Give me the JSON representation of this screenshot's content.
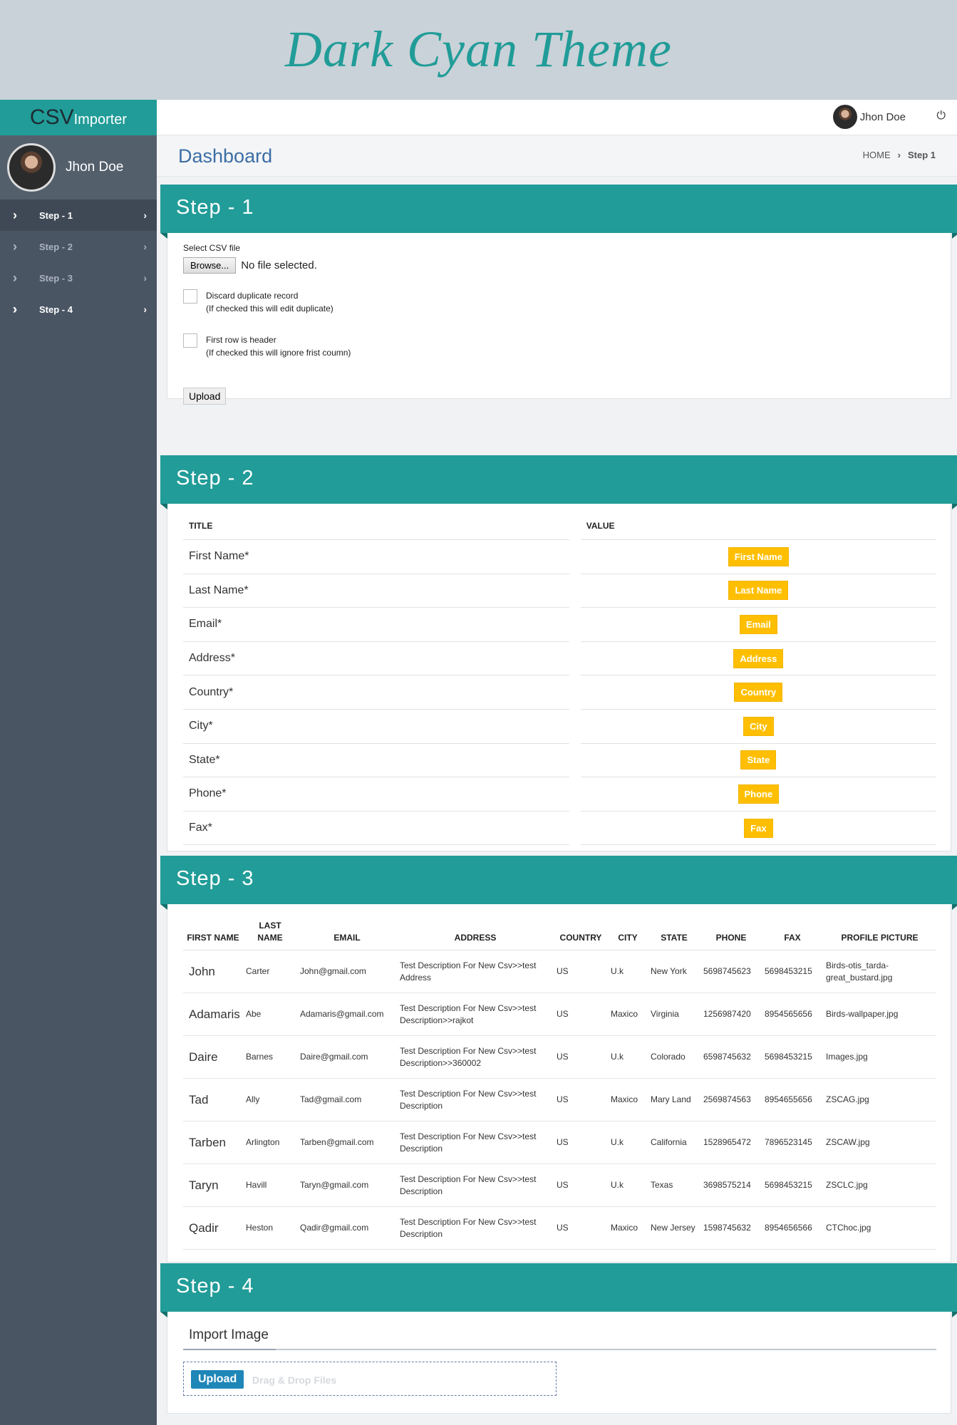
{
  "banner": {
    "title": "Dark Cyan Theme"
  },
  "brand": {
    "part1": "CSV",
    "part2": "Importer"
  },
  "user": {
    "name": "Jhon Doe"
  },
  "sidebar": {
    "items": [
      {
        "label": "Step - 1",
        "icon": "›"
      },
      {
        "label": "Step - 2",
        "icon": "››"
      },
      {
        "label": "Step - 3",
        "icon": "›››"
      },
      {
        "label": "Step - 4",
        "icon": "››››"
      }
    ],
    "chevron": "›"
  },
  "topbar": {
    "user": "Jhon Doe",
    "power_icon": "⏻"
  },
  "header": {
    "title": "Dashboard",
    "breadcrumb": {
      "home": "HOME",
      "sep": "›",
      "current": "Step 1"
    }
  },
  "step1": {
    "title": "Step - 1",
    "select_label": "Select CSV file",
    "browse": "Browse...",
    "file_status": "No file selected.",
    "discard_label": "Discard duplicate record",
    "discard_hint": "(If checked this will edit duplicate)",
    "header_label": "First row is header",
    "header_hint": "(If checked this will ignore frist coumn)",
    "upload": "Upload"
  },
  "step2": {
    "title": "Step - 2",
    "col_title": "TITLE",
    "col_value": "VALUE",
    "rows": [
      {
        "title": "First Name*",
        "value": "First Name"
      },
      {
        "title": "Last Name*",
        "value": "Last Name"
      },
      {
        "title": "Email*",
        "value": "Email"
      },
      {
        "title": "Address*",
        "value": "Address"
      },
      {
        "title": "Country*",
        "value": "Country"
      },
      {
        "title": "City*",
        "value": "City"
      },
      {
        "title": "State*",
        "value": "State"
      },
      {
        "title": "Phone*",
        "value": "Phone"
      },
      {
        "title": "Fax*",
        "value": "Fax"
      }
    ]
  },
  "step3": {
    "title": "Step - 3",
    "columns": [
      "FIRST NAME",
      "LAST NAME",
      "EMAIL",
      "ADDRESS",
      "COUNTRY",
      "CITY",
      "STATE",
      "PHONE",
      "FAX",
      "PROFILE PICTURE"
    ],
    "rows": [
      [
        "John",
        "Carter",
        "John@gmail.com",
        "Test Description For New Csv>>test Address",
        "US",
        "U.k",
        "New York",
        "5698745623",
        "5698453215",
        "Birds-otis_tarda-great_bustard.jpg"
      ],
      [
        "Adamaris",
        "Abe",
        "Adamaris@gmail.com",
        "Test Description For New Csv>>test Description>>rajkot",
        "US",
        "Maxico",
        "Virginia",
        "1256987420",
        "8954565656",
        "Birds-wallpaper.jpg"
      ],
      [
        "Daire",
        "Barnes",
        "Daire@gmail.com",
        "Test Description For New Csv>>test Description>>360002",
        "US",
        "U.k",
        "Colorado",
        "6598745632",
        "5698453215",
        "Images.jpg"
      ],
      [
        "Tad",
        "Ally",
        "Tad@gmail.com",
        "Test Description For New Csv>>test Description",
        "US",
        "Maxico",
        "Mary Land",
        "2569874563",
        "8954655656",
        "ZSCAG.jpg"
      ],
      [
        "Tarben",
        "Arlington",
        "Tarben@gmail.com",
        "Test Description For New Csv>>test Description",
        "US",
        "U.k",
        "California",
        "1528965472",
        "7896523145",
        "ZSCAW.jpg"
      ],
      [
        "Taryn",
        "Havill",
        "Taryn@gmail.com",
        "Test Description For New Csv>>test Description",
        "US",
        "U.k",
        "Texas",
        "3698575214",
        "5698453215",
        "ZSCLC.jpg"
      ],
      [
        "Qadir",
        "Heston",
        "Qadir@gmail.com",
        "Test Description For New Csv>>test Description",
        "US",
        "Maxico",
        "New Jersey",
        "1598745632",
        "8954656566",
        "CTChoc.jpg"
      ]
    ]
  },
  "step4": {
    "title": "Step - 4",
    "import_title": "Import Image",
    "upload": "Upload",
    "drop_hint": "Drag & Drop Files"
  },
  "colors": {
    "accent": "#219c98",
    "sidebar": "#4a5564",
    "tag": "#ffbf00",
    "link": "#3a6ea5"
  }
}
